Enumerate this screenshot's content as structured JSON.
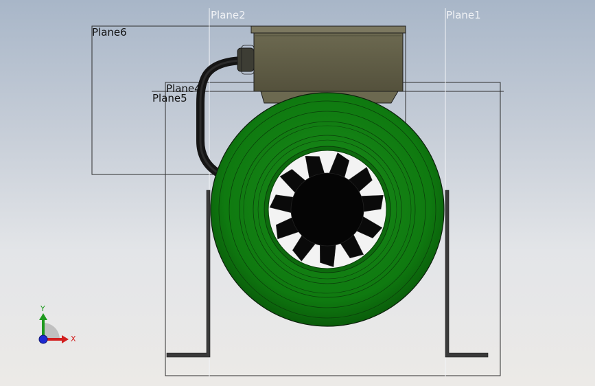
{
  "viewport": {
    "background_top": "#a8b6c8",
    "background_bottom": "#eceae7"
  },
  "planes": {
    "plane1": "Plane1",
    "plane2": "Plane2",
    "plane4": "Plane4",
    "plane5": "Plane5",
    "plane6": "Plane6"
  },
  "triad": {
    "x_label": "X",
    "y_label": "Y",
    "x_color": "#d21e1e",
    "y_color": "#1e9a1e",
    "z_color": "#1e2ad2"
  },
  "model": {
    "fan_housing_color": "#0f7a0f",
    "motor_box_color": "#5e5b44",
    "impeller_color": "#0a0a0a",
    "cable_color": "#1f1f1f",
    "bracket_color": "#3a3a3a",
    "impeller_blades": 11
  }
}
